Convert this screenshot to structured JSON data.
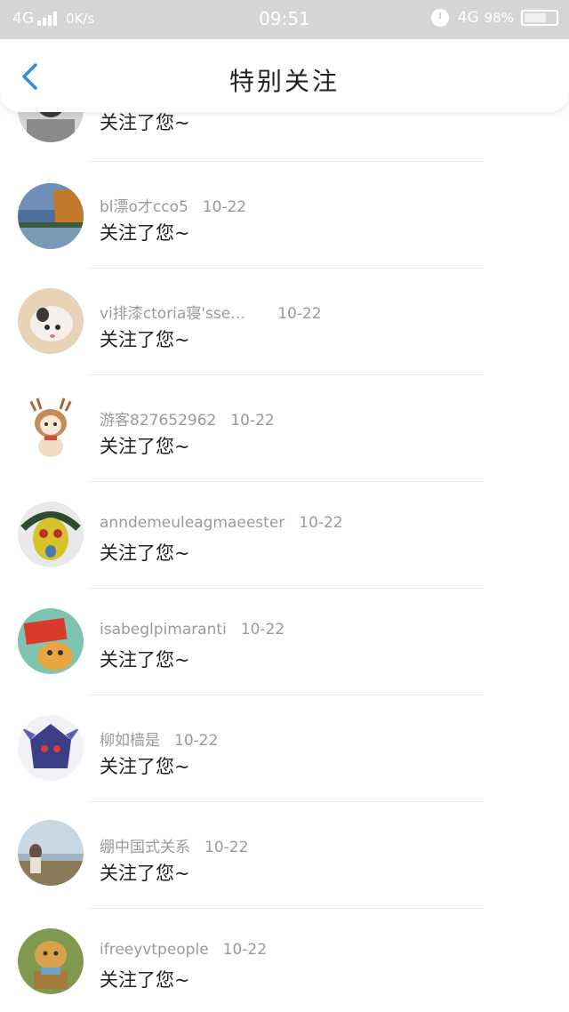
{
  "status_bar": {
    "network_left": "4G",
    "speed": "0K/s",
    "time": "09:51",
    "network_right": "4G",
    "battery": "98%"
  },
  "header": {
    "title": "特别关注"
  },
  "notifications": [
    {
      "name": "",
      "date": "",
      "message": "关注了您~",
      "avatar_color": "#bdbdbd"
    },
    {
      "name": "bl漂o才cco5",
      "date": "10-22",
      "message": "关注了您~",
      "avatar_color": "#5a7aa0"
    },
    {
      "name": "vi排漆ctoria寝'sse…",
      "date": "10-22",
      "message": "关注了您~",
      "avatar_color": "#e9d2b4"
    },
    {
      "name": "游客827652962",
      "date": "10-22",
      "message": "关注了您~",
      "avatar_color": "#f0e4d8"
    },
    {
      "name": "anndemeuleagmaeester",
      "date": "10-22",
      "message": "关注了您~",
      "avatar_color": "#c9b52a"
    },
    {
      "name": "isabeglpimaranti",
      "date": "10-22",
      "message": "关注了您~",
      "avatar_color": "#cf3b2c"
    },
    {
      "name": "柳如樯是",
      "date": "10-22",
      "message": "关注了您~",
      "avatar_color": "#3d3f7a"
    },
    {
      "name": "绷中国式关系",
      "date": "10-22",
      "message": "关注了您~",
      "avatar_color": "#b9c6c9"
    },
    {
      "name": "ifreeyvtpeople",
      "date": "10-22",
      "message": "关注了您~",
      "avatar_color": "#8c9a55"
    }
  ]
}
